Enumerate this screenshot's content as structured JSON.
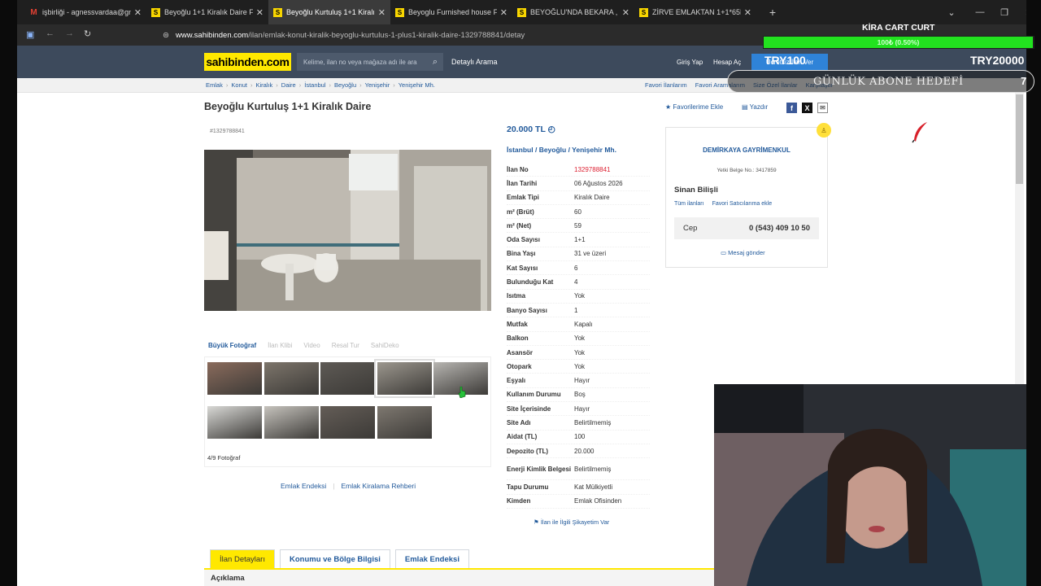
{
  "browser": {
    "tabs": [
      {
        "icon": "gmail-icon",
        "badge": "M",
        "title": "işbirliği - agnessvardaa@gmail.com",
        "active": false
      },
      {
        "icon": "sahibinden-icon",
        "badge": "S",
        "title": "Beyoğlu 1+1 Kiralık Daire Fiyatları",
        "active": false
      },
      {
        "icon": "sahibinden-icon",
        "badge": "S",
        "title": "Beyoğlu Kurtuluş 1+1 Kiralık Daire",
        "active": true
      },
      {
        "icon": "sahibinden-icon",
        "badge": "S",
        "title": "Beyoglu Furnished house For Rent",
        "active": false
      },
      {
        "icon": "sahibinden-icon",
        "badge": "S",
        "title": "BEYOĞLU'NDA BEKARA , YABANCIYA",
        "active": false
      },
      {
        "icon": "sahibinden-icon",
        "badge": "S",
        "title": "ZİRVE EMLAKTAN 1+1*65M2*3.KAT",
        "active": false
      }
    ],
    "new_tab": "+",
    "close": "✕",
    "url_host": "www.sahibinden.com",
    "url_path": "/ilan/emlak-konut-kiralik-beyoglu-kurtulus-1-plus1-kiralik-daire-1329788841/detay"
  },
  "header": {
    "logo": "sahibinden.com",
    "search_placeholder": "Kelime, ilan no veya mağaza adı ile ara",
    "detailed_search": "Detaylı Arama",
    "login": "Giriş Yap",
    "account": "Hesap Aç",
    "post_free": "Ücretsiz İlan Ver"
  },
  "breadcrumb": [
    "Emlak",
    "Konut",
    "Kiralık",
    "Daire",
    "İstanbul",
    "Beyoğlu",
    "Yenişehir",
    "Yenişehir Mh."
  ],
  "top_links": [
    "Favori İlanlarım",
    "Favori Aramalarım",
    "Size Özel İlanlar",
    "Karşılaştır"
  ],
  "listing": {
    "title": "Beyoğlu Kurtuluş 1+1 Kiralık Daire",
    "add_favorites": "Favorilerime Ekle",
    "print": "Yazdır",
    "id_label": "#1329788841",
    "price": "20.000 TL",
    "location": [
      "İstanbul",
      "Beyoğlu",
      "Yenişehir Mh."
    ],
    "details": [
      {
        "k": "İlan No",
        "v": "1329788841",
        "red": true
      },
      {
        "k": "İlan Tarihi",
        "v": "06 Ağustos 2026"
      },
      {
        "k": "Emlak Tipi",
        "v": "Kiralık Daire"
      },
      {
        "k": "m² (Brüt)",
        "v": "60"
      },
      {
        "k": "m² (Net)",
        "v": "59"
      },
      {
        "k": "Oda Sayısı",
        "v": "1+1"
      },
      {
        "k": "Bina Yaşı",
        "v": "31 ve üzeri"
      },
      {
        "k": "Kat Sayısı",
        "v": "6"
      },
      {
        "k": "Bulunduğu Kat",
        "v": "4"
      },
      {
        "k": "Isıtma",
        "v": "Yok"
      },
      {
        "k": "Banyo Sayısı",
        "v": "1"
      },
      {
        "k": "Mutfak",
        "v": "Kapalı"
      },
      {
        "k": "Balkon",
        "v": "Yok"
      },
      {
        "k": "Asansör",
        "v": "Yok"
      },
      {
        "k": "Otopark",
        "v": "Yok"
      },
      {
        "k": "Eşyalı",
        "v": "Hayır"
      },
      {
        "k": "Kullanım Durumu",
        "v": "Boş"
      },
      {
        "k": "Site İçerisinde",
        "v": "Hayır"
      },
      {
        "k": "Site Adı",
        "v": "Belirtilmemiş"
      },
      {
        "k": "Aidat (TL)",
        "v": "100"
      },
      {
        "k": "Depozito (TL)",
        "v": "20.000"
      },
      {
        "k": "Enerji Kimlik Belgesi",
        "v": "Belirtilmemiş",
        "tall": true
      },
      {
        "k": "Tapu Durumu",
        "v": "Kat Mülkiyetli"
      },
      {
        "k": "Kimden",
        "v": "Emlak Ofisinden"
      }
    ],
    "complaint": "İlan ile İlgili Şikayetim Var"
  },
  "photos": {
    "tools": [
      "Büyük Fotoğraf",
      "İlan Klibi",
      "Video",
      "Resal Tur",
      "SahiDeko"
    ],
    "count": "4/9 Fotoğraf",
    "thumb_count": 9,
    "selected": 4
  },
  "emlak_links": [
    "Emlak Endeksi",
    "Emlak Kiralama Rehberi"
  ],
  "agent": {
    "company": "DEMİRKAYA GAYRİMENKUL",
    "cert": "Yetki Belge No.: 3417859",
    "person": "Sinan Bilişli",
    "links": [
      "Tüm ilanları",
      "Favori Satıcılarıma ekle"
    ],
    "phone_label": "Cep",
    "phone": "0 (543) 409 10 50",
    "message": "Mesaj gönder"
  },
  "bottom_tabs": [
    "İlan Detayları",
    "Konumu ve Bölge Bilgisi",
    "Emlak Endeksi"
  ],
  "description_label": "Açıklama",
  "overlay": {
    "goal_title": "KİRA CART CURT",
    "goal_progress": "100₺ (0.50%)",
    "goal_fraction": 0.005,
    "min": "TRY100",
    "max": "TRY20000",
    "subs_goal": "GÜNLÜK ABONE HEDEFİ",
    "subs_count": "7"
  },
  "colors": {
    "brand_yellow": "#ffe800",
    "link_blue": "#225a9b",
    "header_bg": "#3d4a5c",
    "goal_green": "#22e21f"
  }
}
